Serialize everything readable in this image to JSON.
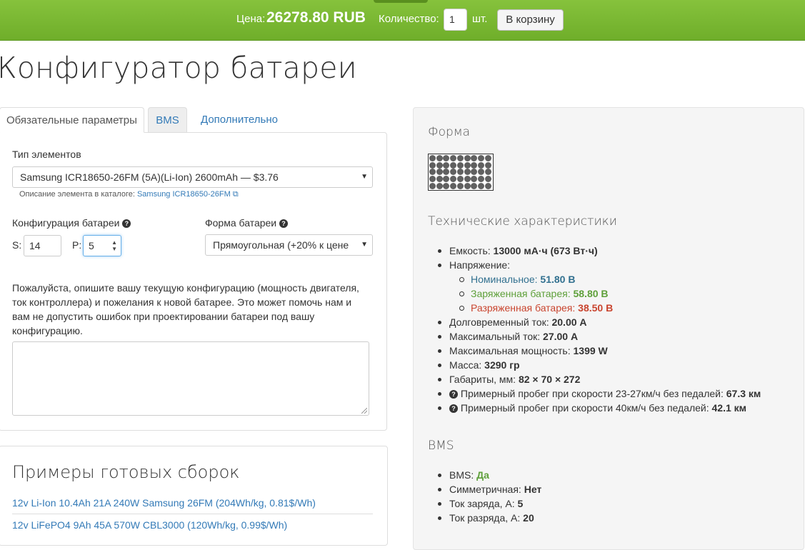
{
  "topbar": {
    "price_label": "Цена:",
    "price_value": "26278.80 RUB",
    "qty_label": "Количество:",
    "qty_value": "1",
    "qty_unit": "шт.",
    "cart_button": "В корзину"
  },
  "page_title": "Конфигуратор батареи",
  "tabs": {
    "required": "Обязательные параметры",
    "bms": "BMS",
    "extra": "Дополнительно"
  },
  "form": {
    "cell_type_label": "Тип элементов",
    "cell_type_value": "Samsung ICR18650-26FM (5A)(Li-Ion) 2600mAh — $3.76",
    "catalog_note": "Описание элемента в каталоге:",
    "catalog_link": "Samsung ICR18650-26FM",
    "config_label": "Конфигурация батареи",
    "s_label": "S:",
    "s_value": "14",
    "p_label": "P:",
    "p_value": "5",
    "shape_label": "Форма батареи",
    "shape_value": "Прямоугольная (+20% к цене",
    "description": "Пожалуйста, опишите вашу текущую конфигурацию (мощность двигателя, ток контроллера) и пожелания к новой батарее. Это может помочь нам и вам не допустить ошибок при проектировании батареи под вашу конфигурацию.",
    "textarea_value": ""
  },
  "examples": {
    "title": "Примеры готовых сборок",
    "items": [
      "12v Li-Ion 10.4Ah 21A 240W Samsung 26FM (204Wh/kg, 0.81$/Wh)",
      "12v LiFePO4 9Ah 45A 570W CBL3000 (120Wh/kg, 0.99$/Wh)"
    ]
  },
  "right": {
    "shape_title": "Форма",
    "shape_grid": {
      "rows": 5,
      "cols": 9
    },
    "tech_title": "Технические характеристики",
    "capacity_label": "Емкость:",
    "capacity_value": "13000 мА·ч (673 Вт·ч)",
    "voltage_label": "Напряжение:",
    "nominal_label": "Номинальное:",
    "nominal_value": "51.80 В",
    "charged_label": "Заряженная батарея:",
    "charged_value": "58.80 В",
    "discharged_label": "Разряженная батарея:",
    "discharged_value": "38.50 В",
    "cont_current_label": "Долговременный ток:",
    "cont_current_value": "20.00 А",
    "max_current_label": "Максимальный ток:",
    "max_current_value": "27.00 А",
    "max_power_label": "Максимальная мощность:",
    "max_power_value": "1399 W",
    "mass_label": "Масса:",
    "mass_value": "3290 гр",
    "dims_label": "Габариты, мм:",
    "dims_value": "82 × 70 × 272",
    "range1_label": "Примерный пробег при скорости 23-27км/ч без педалей:",
    "range1_value": "67.3 км",
    "range2_label": "Примерный пробег при скорости 40км/ч без педалей:",
    "range2_value": "42.1 км",
    "bms_title": "BMS",
    "bms_label": "BMS:",
    "bms_value": "Да",
    "symmetric_label": "Симметричная:",
    "symmetric_value": "Нет",
    "charge_current_label": "Ток заряда, А:",
    "charge_current_value": "5",
    "discharge_current_label": "Ток разряда, А:",
    "discharge_current_value": "20"
  },
  "colors": {
    "topbar": "#7ab834",
    "link": "#337ab7",
    "nominal": "#31708f",
    "charged": "#5fa03b",
    "discharged": "#c9452f"
  }
}
